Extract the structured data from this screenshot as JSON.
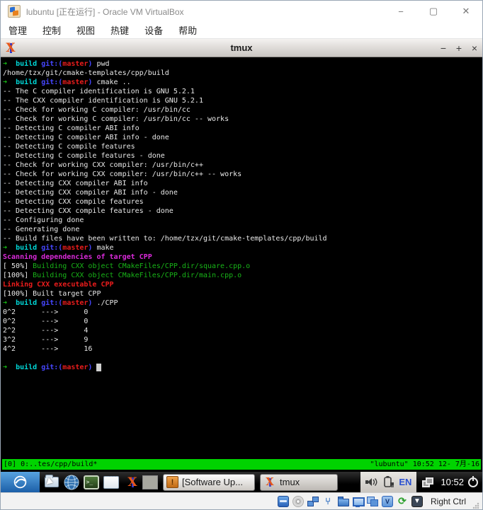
{
  "window": {
    "title": "lubuntu [正在运行] - Oracle VM VirtualBox",
    "controls": {
      "minimize": "−",
      "maximize": "▢",
      "close": "✕"
    }
  },
  "menubar": {
    "items": [
      "管理",
      "控制",
      "视图",
      "热键",
      "设备",
      "帮助"
    ]
  },
  "tmux_window": {
    "title": "tmux",
    "controls": {
      "minimize": "−",
      "maximize": "+",
      "close": "×"
    }
  },
  "terminal": {
    "palette": {
      "garrow": {
        "color": "#17c317",
        "bold": true
      },
      "cyan": {
        "color": "#00d8d8",
        "bold": true
      },
      "blue": {
        "color": "#4646ff",
        "bold": true
      },
      "red": {
        "color": "#ea1c1c",
        "bold": true
      },
      "magenta": {
        "color": "#da2ada",
        "bold": true
      },
      "green": {
        "color": "#18b418",
        "bold": false
      },
      "white": {
        "color": "#e9e9e9",
        "bold": false
      },
      "cursor": {
        "color": "#000000",
        "bg": "#d0d0d0",
        "bold": false
      }
    },
    "lines": [
      [
        [
          "garrow",
          "➜  "
        ],
        [
          "cyan",
          "build"
        ],
        [
          "blue",
          " git:("
        ],
        [
          "red",
          "master"
        ],
        [
          "blue",
          ")"
        ],
        [
          "white",
          " pwd"
        ]
      ],
      [
        [
          "white",
          "/home/tzx/git/cmake-templates/cpp/build"
        ]
      ],
      [
        [
          "garrow",
          "➜  "
        ],
        [
          "cyan",
          "build"
        ],
        [
          "blue",
          " git:("
        ],
        [
          "red",
          "master"
        ],
        [
          "blue",
          ")"
        ],
        [
          "white",
          " cmake .."
        ]
      ],
      [
        [
          "white",
          "-- The C compiler identification is GNU 5.2.1"
        ]
      ],
      [
        [
          "white",
          "-- The CXX compiler identification is GNU 5.2.1"
        ]
      ],
      [
        [
          "white",
          "-- Check for working C compiler: /usr/bin/cc"
        ]
      ],
      [
        [
          "white",
          "-- Check for working C compiler: /usr/bin/cc -- works"
        ]
      ],
      [
        [
          "white",
          "-- Detecting C compiler ABI info"
        ]
      ],
      [
        [
          "white",
          "-- Detecting C compiler ABI info - done"
        ]
      ],
      [
        [
          "white",
          "-- Detecting C compile features"
        ]
      ],
      [
        [
          "white",
          "-- Detecting C compile features - done"
        ]
      ],
      [
        [
          "white",
          "-- Check for working CXX compiler: /usr/bin/c++"
        ]
      ],
      [
        [
          "white",
          "-- Check for working CXX compiler: /usr/bin/c++ -- works"
        ]
      ],
      [
        [
          "white",
          "-- Detecting CXX compiler ABI info"
        ]
      ],
      [
        [
          "white",
          "-- Detecting CXX compiler ABI info - done"
        ]
      ],
      [
        [
          "white",
          "-- Detecting CXX compile features"
        ]
      ],
      [
        [
          "white",
          "-- Detecting CXX compile features - done"
        ]
      ],
      [
        [
          "white",
          "-- Configuring done"
        ]
      ],
      [
        [
          "white",
          "-- Generating done"
        ]
      ],
      [
        [
          "white",
          "-- Build files have been written to: /home/tzx/git/cmake-templates/cpp/build"
        ]
      ],
      [
        [
          "garrow",
          "➜  "
        ],
        [
          "cyan",
          "build"
        ],
        [
          "blue",
          " git:("
        ],
        [
          "red",
          "master"
        ],
        [
          "blue",
          ")"
        ],
        [
          "white",
          " make"
        ]
      ],
      [
        [
          "magenta",
          "Scanning dependencies of target CPP"
        ]
      ],
      [
        [
          "white",
          "[ 50%] "
        ],
        [
          "green",
          "Building CXX object CMakeFiles/CPP.dir/square.cpp.o"
        ]
      ],
      [
        [
          "white",
          "[100%] "
        ],
        [
          "green",
          "Building CXX object CMakeFiles/CPP.dir/main.cpp.o"
        ]
      ],
      [
        [
          "red",
          "Linking CXX executable CPP"
        ]
      ],
      [
        [
          "white",
          "[100%] Built target CPP"
        ]
      ],
      [
        [
          "garrow",
          "➜  "
        ],
        [
          "cyan",
          "build"
        ],
        [
          "blue",
          " git:("
        ],
        [
          "red",
          "master"
        ],
        [
          "blue",
          ")"
        ],
        [
          "white",
          " ./CPP"
        ]
      ],
      [
        [
          "white",
          "0^2      --->      0"
        ]
      ],
      [
        [
          "white",
          "0^2      --->      0"
        ]
      ],
      [
        [
          "white",
          "2^2      --->      4"
        ]
      ],
      [
        [
          "white",
          "3^2      --->      9"
        ]
      ],
      [
        [
          "white",
          "4^2      --->      16"
        ]
      ],
      [],
      [
        [
          "garrow",
          "➜  "
        ],
        [
          "cyan",
          "build"
        ],
        [
          "blue",
          " git:("
        ],
        [
          "red",
          "master"
        ],
        [
          "blue",
          ") "
        ],
        [
          "cursor",
          " "
        ]
      ]
    ]
  },
  "tmux_status": {
    "left": "[0] 0:..tes/cpp/build*",
    "right": "\"lubuntu\" 10:52 12- 7月-16"
  },
  "taskbar": {
    "tasks": [
      {
        "label": "[Software Up..."
      },
      {
        "label": "tmux"
      }
    ],
    "tray": {
      "input_method": "EN",
      "clock": "10:52"
    }
  },
  "glyphs": {
    "terminal_launcher": ">_",
    "updater_bang": "!",
    "features_chip": "V",
    "mouse_arrows": "⟳",
    "keyboard_arrow": "▼",
    "usb": "⑂"
  },
  "vbox_status": {
    "host_key": "Right Ctrl"
  }
}
